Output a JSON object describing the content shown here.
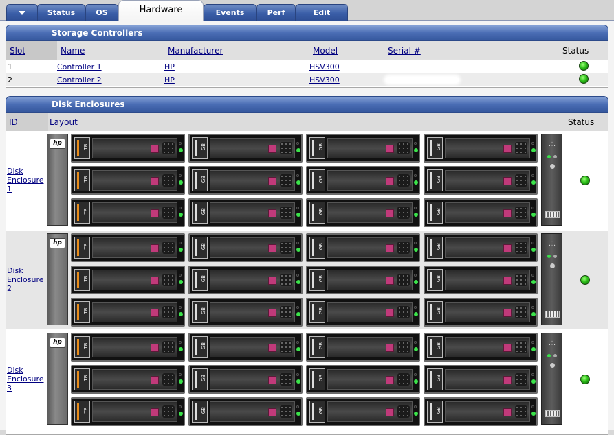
{
  "tabs": [
    {
      "label": "",
      "icon": "dropdown-triangle-icon"
    },
    {
      "label": "Status"
    },
    {
      "label": "OS"
    },
    {
      "label": "Hardware",
      "active": true
    },
    {
      "label": "Events"
    },
    {
      "label": "Perf"
    },
    {
      "label": "Edit"
    }
  ],
  "storage_controllers": {
    "title": "Storage Controllers",
    "columns": {
      "slot": "Slot",
      "name": "Name",
      "manufacturer": "Manufacturer",
      "model": "Model",
      "serial": "Serial #",
      "status": "Status"
    },
    "rows": [
      {
        "slot": "1",
        "name": "Controller 1",
        "manufacturer": "HP",
        "model": "HSV300",
        "serial": "",
        "status": "ok"
      },
      {
        "slot": "2",
        "name": "Controller 2",
        "manufacturer": "HP",
        "model": "HSV300",
        "serial": "",
        "status": "ok"
      }
    ]
  },
  "disk_enclosures": {
    "title": "Disk Enclosures",
    "columns": {
      "id": "ID",
      "layout": "Layout",
      "status": "Status"
    },
    "rows": [
      {
        "id_line1": "Disk",
        "id_line2": "Enclosure",
        "id_line3": "1",
        "status": "ok"
      },
      {
        "id_line1": "Disk",
        "id_line2": "Enclosure",
        "id_line3": "2",
        "status": "ok"
      },
      {
        "id_line1": "Disk",
        "id_line2": "Enclosure",
        "id_line3": "3",
        "status": "ok"
      }
    ],
    "drive_capacity_labels": [
      "TB",
      "GB",
      "GB",
      "GB"
    ],
    "logo_text": "hp"
  },
  "colors": {
    "tab_blue": "#3a5ea8",
    "header_blue": "#4a6db4",
    "status_ok_green": "#2fc11a",
    "drive_latch": "#c03a7a",
    "tb_stripe": "#e88c1b"
  }
}
